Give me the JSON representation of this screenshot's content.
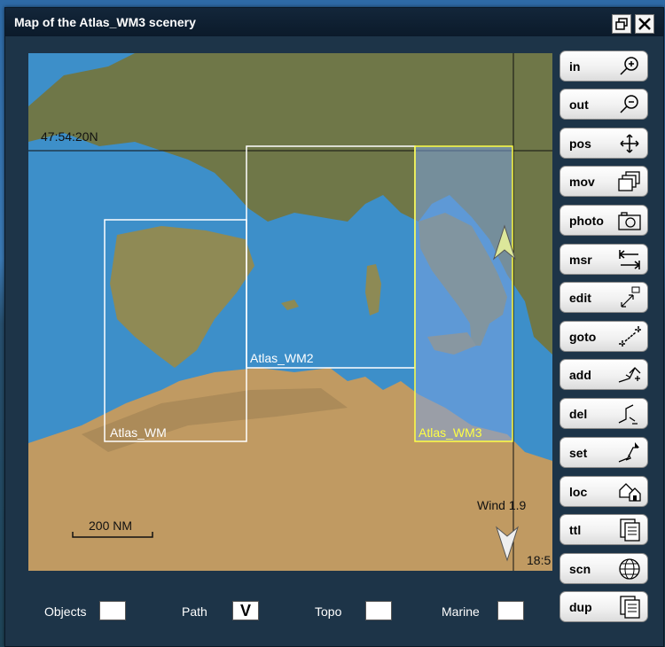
{
  "window": {
    "title": "Map of the Atlas_WM3 scenery"
  },
  "map": {
    "latitude_label": "47:54:20N",
    "time_label": "18:5",
    "regions": [
      "Atlas_WM",
      "Atlas_WM2",
      "Atlas_WM3"
    ],
    "selected_region": "Atlas_WM3",
    "scale_label": "200 NM",
    "wind_label": "Wind 1.9"
  },
  "tools": [
    {
      "label": "in",
      "icon": "zoom-in-icon"
    },
    {
      "label": "out",
      "icon": "zoom-out-icon"
    },
    {
      "label": "pos",
      "icon": "move-arrows-icon"
    },
    {
      "label": "mov",
      "icon": "windows-stack-icon"
    },
    {
      "label": "photo",
      "icon": "camera-icon"
    },
    {
      "label": "msr",
      "icon": "measure-icon"
    },
    {
      "label": "edit",
      "icon": "resize-icon"
    },
    {
      "label": "goto",
      "icon": "goto-icon"
    },
    {
      "label": "add",
      "icon": "add-point-icon"
    },
    {
      "label": "del",
      "icon": "delete-point-icon"
    },
    {
      "label": "set",
      "icon": "set-point-icon"
    },
    {
      "label": "loc",
      "icon": "location-houses-icon"
    },
    {
      "label": "ttl",
      "icon": "document-icon"
    },
    {
      "label": "scn",
      "icon": "globe-icon"
    },
    {
      "label": "dup",
      "icon": "duplicate-icon"
    }
  ],
  "options": {
    "objects": {
      "label": "Objects",
      "checked": false,
      "mark": ""
    },
    "path": {
      "label": "Path",
      "checked": true,
      "mark": "V"
    },
    "topo": {
      "label": "Topo",
      "checked": false,
      "mark": ""
    },
    "marine": {
      "label": "Marine",
      "checked": false,
      "mark": ""
    }
  },
  "colors": {
    "sea": "#3d8fc9",
    "land": "#b08a52",
    "selected_region": "#ffff44"
  }
}
